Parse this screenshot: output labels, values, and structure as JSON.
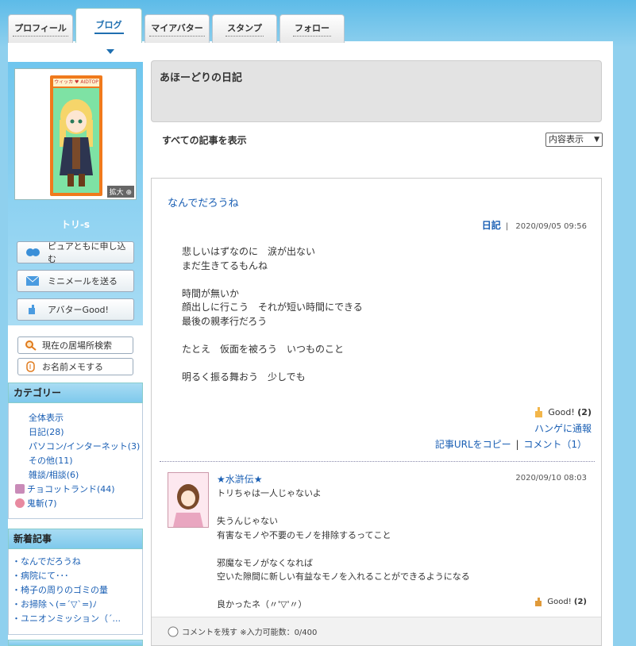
{
  "tabs": [
    {
      "label": "プロフィール"
    },
    {
      "label": "ブログ"
    },
    {
      "label": "マイアバター"
    },
    {
      "label": "スタンプ"
    },
    {
      "label": "フォロー"
    }
  ],
  "sidebar": {
    "avatar_logo": "ウィッカ ♥ AIDTOP",
    "enlarge_label": "拡大",
    "user_name": "トリ-s",
    "buttons": [
      {
        "label": "ピュアともに申し込む",
        "icon": "pure-icon"
      },
      {
        "label": "ミニメールを送る",
        "icon": "mail-icon"
      },
      {
        "label": "アバターGood!",
        "icon": "good-hand-icon"
      }
    ],
    "small_buttons": [
      {
        "label": "現在の居場所検索",
        "icon": "search-icon"
      },
      {
        "label": "お名前メモする",
        "icon": "memo-icon"
      }
    ],
    "category_header": "カテゴリー",
    "categories": [
      "全体表示",
      "日記(28)",
      "パソコン/インターネット(3)",
      "その他(11)",
      "雑談/相談(6)",
      "チョコットランド(44)",
      "鬼斬(7)"
    ],
    "new_header": "新着記事",
    "new_posts": [
      "・なんでだろうね",
      "・病院にて･･･",
      "・椅子の周りのゴミの量",
      "・お掃除ヽ(=´▽`=)ﾉ",
      "・ユニオンミッション（´..."
    ]
  },
  "main": {
    "diary_title": "あほーどりの日記",
    "show_all": "すべての記事を表示",
    "display_select": "内容表示",
    "article": {
      "title": "なんでだろうね",
      "category": "日記",
      "separator": "|",
      "date": "2020/09/05 09:56",
      "body": [
        "悲しいはずなのに　涙が出ない",
        "まだ生きてるもんね",
        "",
        "時間が無いか",
        "顔出しに行こう　それが短い時間にできる",
        "最後の親孝行だろう",
        "",
        "たとえ　仮面を被ろう　いつものこと",
        "",
        "明るく振る舞おう　少しでも"
      ],
      "good_label": "Good!",
      "good_count": "(2)",
      "report": "ハンゲに通報",
      "copy_url": "記事URLをコピー",
      "link_sep": "|",
      "comment_link": "コメント（1）"
    },
    "comment": {
      "name": "★水滸伝★",
      "date": "2020/09/10 08:03",
      "body": [
        "トリちゃは一人じゃないよ",
        "",
        "失うんじゃない",
        "有害なモノや不要のモノを排除するってこと",
        "",
        "邪魔なモノがなくなれば",
        "空いた隙間に新しい有益なモノを入れることができるようになる",
        "",
        "良かったネ（〃'▽'〃）"
      ],
      "good_label": "Good!",
      "good_count": "(2)"
    },
    "leave_comment": "コメントを残す",
    "input_limit": "※入力可能数：0/400"
  }
}
